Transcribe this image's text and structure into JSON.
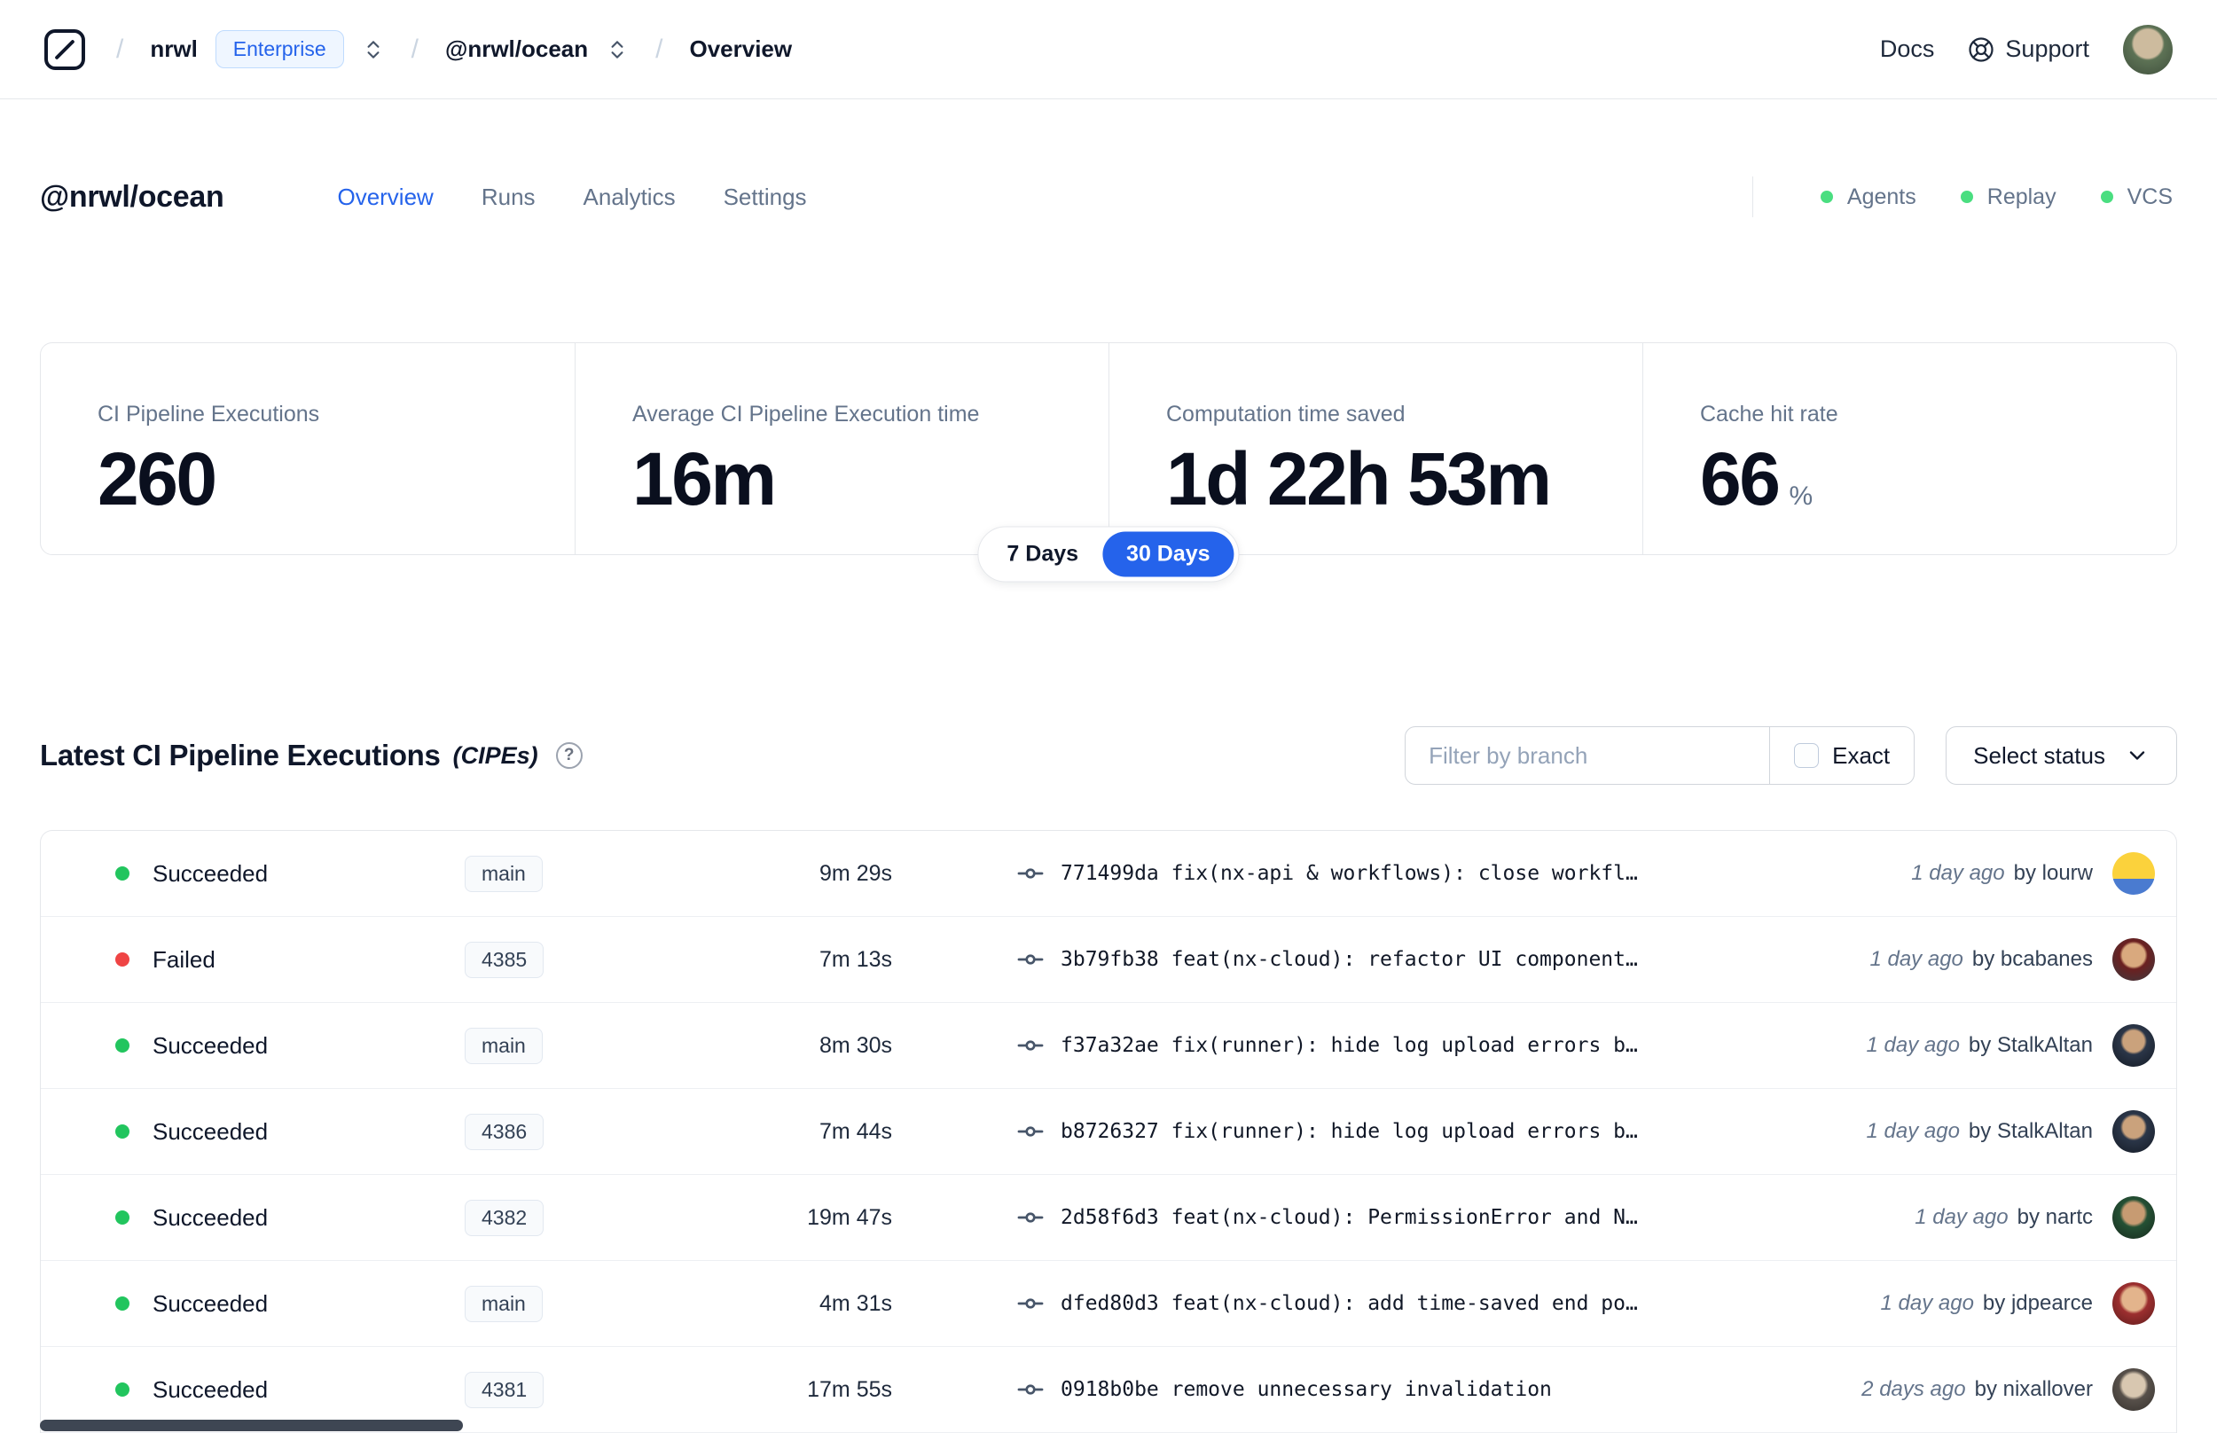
{
  "topbar": {
    "separator": "/",
    "org": {
      "name": "nrwl",
      "badge": "Enterprise"
    },
    "workspace": "@nrwl/ocean",
    "page": "Overview",
    "docs": "Docs",
    "support": "Support"
  },
  "header": {
    "title": "@nrwl/ocean",
    "tabs": [
      {
        "label": "Overview",
        "active": true
      },
      {
        "label": "Runs",
        "active": false
      },
      {
        "label": "Analytics",
        "active": false
      },
      {
        "label": "Settings",
        "active": false
      }
    ],
    "integrations": [
      {
        "label": "Agents"
      },
      {
        "label": "Replay"
      },
      {
        "label": "VCS"
      }
    ]
  },
  "stats": {
    "cards": [
      {
        "label": "CI Pipeline Executions",
        "value": "260"
      },
      {
        "label": "Average CI Pipeline Execution time",
        "value": "16m"
      },
      {
        "label": "Computation time saved",
        "value": "1d 22h 53m"
      },
      {
        "label": "Cache hit rate",
        "value": "66",
        "suffix": "%"
      }
    ],
    "range_toggle": [
      {
        "label": "7 Days",
        "active": false
      },
      {
        "label": "30 Days",
        "active": true
      }
    ]
  },
  "cipes": {
    "title": "Latest CI Pipeline Executions",
    "title_suffix": "(CIPEs)",
    "help_glyph": "?",
    "filter": {
      "placeholder": "Filter by branch",
      "exact_label": "Exact",
      "exact_checked": false
    },
    "status_select_label": "Select status",
    "rows": [
      {
        "status": "Succeeded",
        "status_color": "green",
        "branch": "main",
        "duration": "9m 29s",
        "hash": "771499da",
        "message": "fix(nx-api & workflows): close workfl…",
        "time": "1 day ago",
        "author": "by lourw"
      },
      {
        "status": "Failed",
        "status_color": "red",
        "branch": "4385",
        "duration": "7m 13s",
        "hash": "3b79fb38",
        "message": "feat(nx-cloud): refactor UI component…",
        "time": "1 day ago",
        "author": "by bcabanes"
      },
      {
        "status": "Succeeded",
        "status_color": "green",
        "branch": "main",
        "duration": "8m 30s",
        "hash": "f37a32ae",
        "message": "fix(runner): hide log upload errors b…",
        "time": "1 day ago",
        "author": "by StalkAltan"
      },
      {
        "status": "Succeeded",
        "status_color": "green",
        "branch": "4386",
        "duration": "7m 44s",
        "hash": "b8726327",
        "message": "fix(runner): hide log upload errors b…",
        "time": "1 day ago",
        "author": "by StalkAltan"
      },
      {
        "status": "Succeeded",
        "status_color": "green",
        "branch": "4382",
        "duration": "19m 47s",
        "hash": "2d58f6d3",
        "message": "feat(nx-cloud): PermissionError and N…",
        "time": "1 day ago",
        "author": "by nartc"
      },
      {
        "status": "Succeeded",
        "status_color": "green",
        "branch": "main",
        "duration": "4m 31s",
        "hash": "dfed80d3",
        "message": "feat(nx-cloud): add time-saved end po…",
        "time": "1 day ago",
        "author": "by jdpearce"
      },
      {
        "status": "Succeeded",
        "status_color": "green",
        "branch": "4381",
        "duration": "17m 55s",
        "hash": "0918b0be",
        "message": "remove unnecessary invalidation",
        "time": "2 days ago",
        "author": "by nixallover"
      }
    ]
  },
  "colors": {
    "accent_blue": "#2563eb",
    "success_green": "#22c55e",
    "failure_red": "#ef4444",
    "integration_green": "#4ade80",
    "border_gray": "#e5e7eb"
  }
}
